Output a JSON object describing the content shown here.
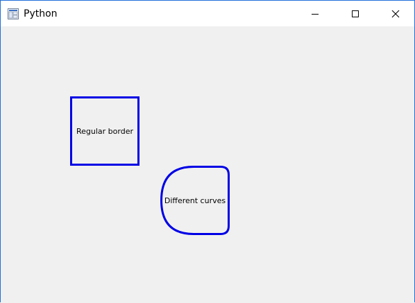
{
  "window": {
    "title": "Python",
    "minimize_label": "Minimize",
    "maximize_label": "Maximize",
    "close_label": "Close"
  },
  "labels": {
    "regular": "Regular border",
    "curves": "Different curves"
  },
  "colors": {
    "border": "#0000e6",
    "client_background": "#f0f0f0",
    "titlebar_background": "#ffffff",
    "window_frame": "#1e6fd9"
  },
  "icons": {
    "app": "python-app-icon",
    "minimize": "minimize-icon",
    "maximize": "maximize-icon",
    "close": "close-icon"
  }
}
